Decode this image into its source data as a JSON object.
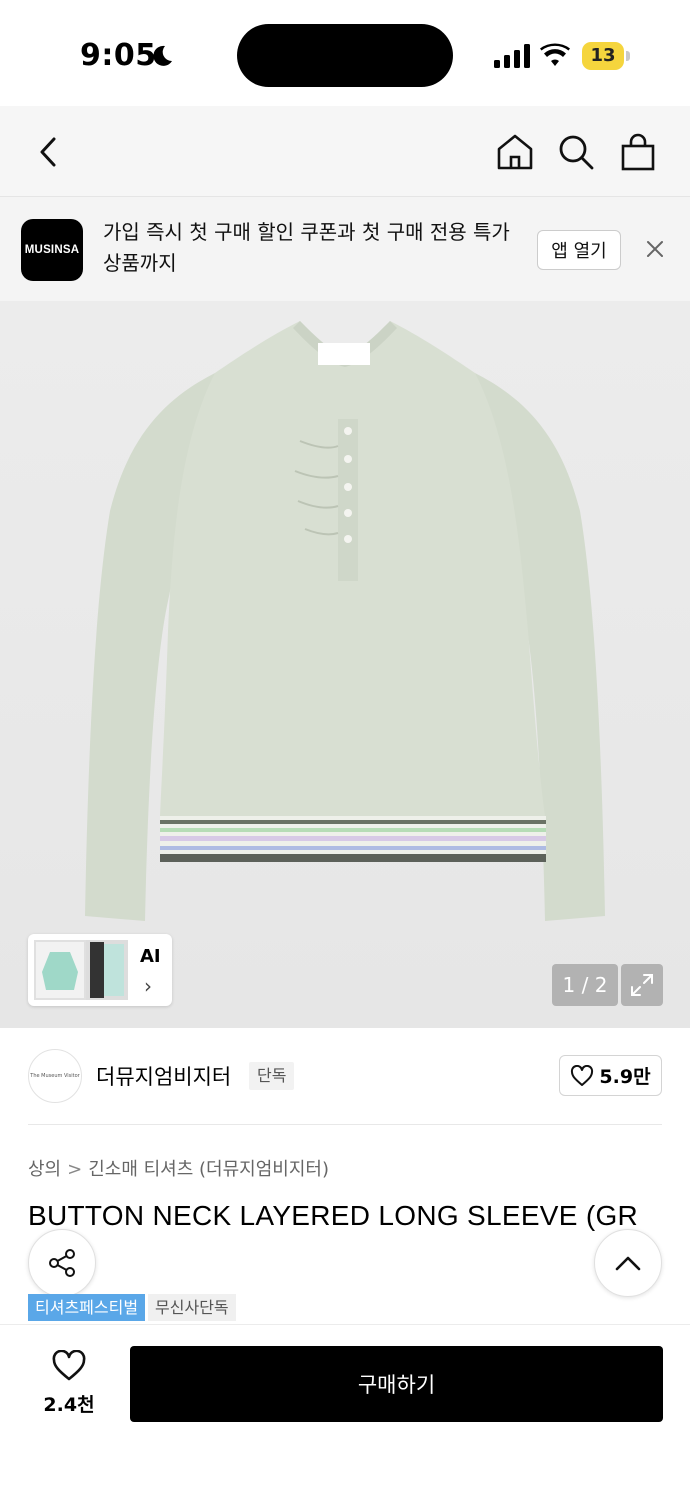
{
  "status_bar": {
    "time": "9:05",
    "battery": "13"
  },
  "nav": {
    "back_icon": "chevron-left-icon",
    "home_icon": "home-icon",
    "search_icon": "search-icon",
    "cart_icon": "shopping-bag-icon"
  },
  "banner": {
    "logo_text": "MUSINSA",
    "message": "가입 즉시 첫 구매 할인 쿠폰과 첫 구매 전용 특가 상품까지",
    "open_app_label": "앱 열기",
    "close_icon": "close-icon"
  },
  "gallery": {
    "ai_label": "AI",
    "ai_chevron": "›",
    "pager": "1 / 2",
    "expand_icon": "expand-icon"
  },
  "brand": {
    "name": "더뮤지엄비지터",
    "badge": "단독",
    "avatar_text": "The Museum Visitor",
    "likes": "5.9만"
  },
  "product": {
    "breadcrumb": [
      "상의",
      "긴소매 티셔츠 (더뮤지엄비지터)"
    ],
    "breadcrumb_sep": ">",
    "title": "BUTTON NECK LAYERED LONG SLEEVE (GR",
    "tags": [
      "티셔츠페스티벌",
      "무신사단독"
    ]
  },
  "bottom_bar": {
    "wish_count": "2.4천",
    "buy_label": "구매하기"
  },
  "colors": {
    "accent_tag": "#5aa7e8",
    "shirt": "#d6ddd0",
    "battery": "#f5d53d"
  }
}
